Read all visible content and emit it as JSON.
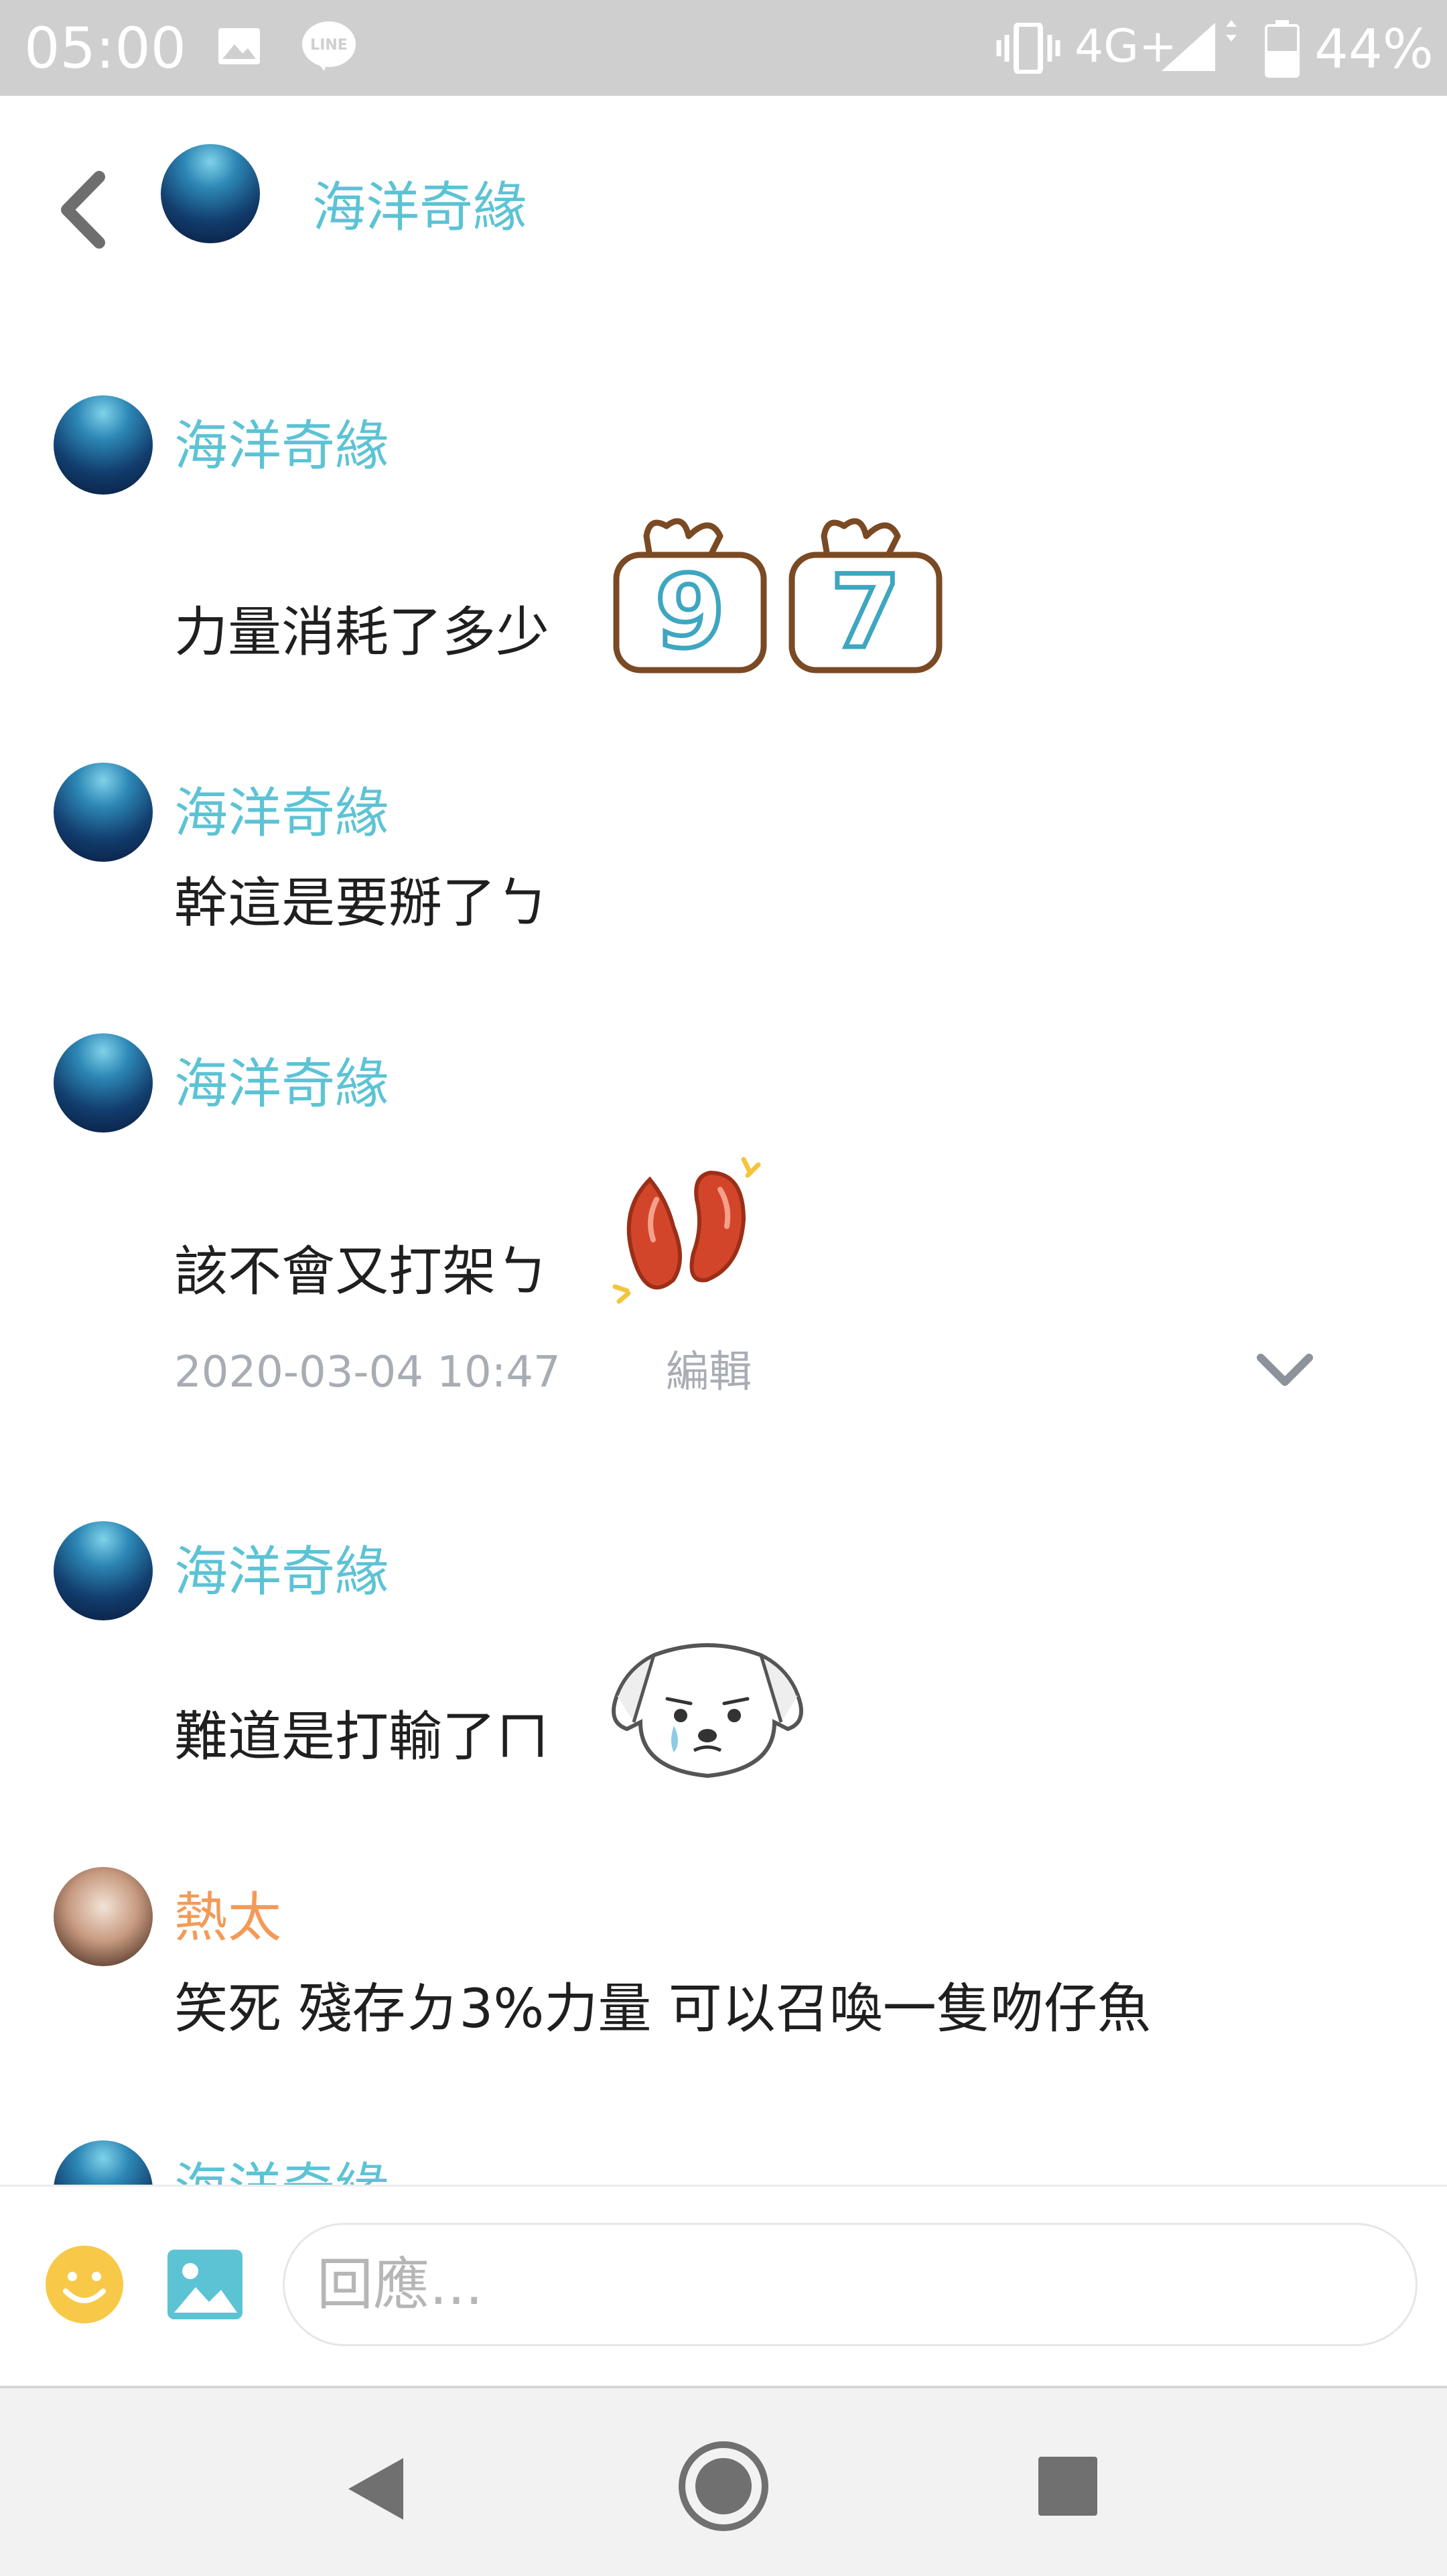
{
  "status_bar": {
    "time": "05:00",
    "network": "4G+",
    "battery": "44%",
    "icons": [
      "gallery-icon",
      "line-app-icon",
      "vibrate-icon",
      "signal-icon",
      "battery-icon"
    ]
  },
  "header": {
    "title": "海洋奇緣",
    "back_icon": "chevron-left-icon"
  },
  "messages": [
    {
      "sender": "海洋奇緣",
      "text": "力量消耗了多少",
      "sticker": "number-97-sticker",
      "sticker_digits": [
        "9",
        "7"
      ]
    },
    {
      "sender": "海洋奇緣",
      "text": "幹這是要掰了ㄅ"
    },
    {
      "sender": "海洋奇緣",
      "text": "該不會又打架ㄅ",
      "sticker": "red-beans-sticker",
      "meta": {
        "timestamp": "2020-03-04 10:47",
        "edit_label": "編輯",
        "menu_icon": "chevron-down-icon"
      }
    },
    {
      "sender": "海洋奇緣",
      "text": "難道是打輸了ㄇ",
      "sticker": "crying-dog-sticker"
    },
    {
      "sender": "熱太",
      "text": "笑死 殘存ㄉ3%力量 可以召喚一隻吻仔魚"
    },
    {
      "sender": "海洋奇緣",
      "text": ""
    }
  ],
  "reply_bar": {
    "placeholder": "回應...",
    "emoji_icon": "smiley-icon",
    "image_icon": "image-icon"
  },
  "nav_bar": {
    "icons": [
      "nav-back-icon",
      "nav-home-icon",
      "nav-recents-icon"
    ]
  },
  "colors": {
    "sender_blue": "#5cc3d5",
    "sender_orange": "#f39a57",
    "meta_gray": "#a8adb4",
    "emoji_yellow": "#f8c948",
    "sticker_brown": "#7a4a24",
    "sticker_red": "#d3452a"
  }
}
